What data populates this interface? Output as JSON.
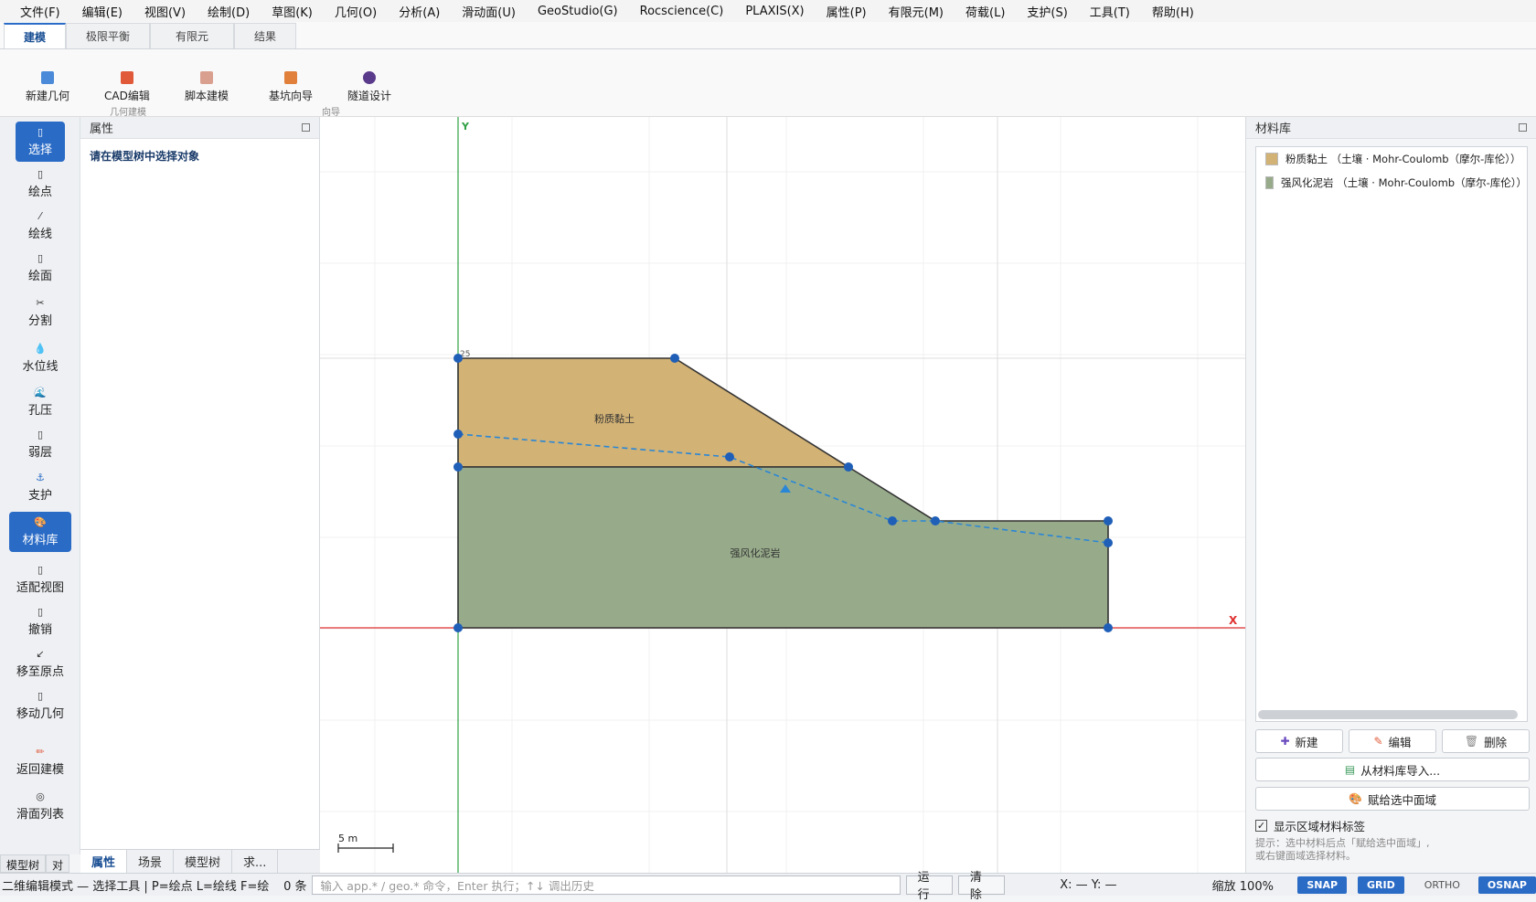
{
  "menu": [
    "文件(F)",
    "编辑(E)",
    "视图(V)",
    "绘制(D)",
    "草图(K)",
    "几何(O)",
    "分析(A)",
    "滑动面(U)",
    "GeoStudio(G)",
    "Rocscience(C)",
    "PLAXIS(X)",
    "属性(P)",
    "有限元(M)",
    "荷载(L)",
    "支护(S)",
    "工具(T)",
    "帮助(H)"
  ],
  "ribbon": {
    "tabs": [
      "建模",
      "极限平衡",
      "有限元",
      "结果"
    ],
    "buttons": [
      "新建几何",
      "CAD编辑",
      "脚本建模",
      "基坑向导",
      "隧道设计"
    ],
    "groups": [
      "几何建模",
      "向导"
    ]
  },
  "toolbar": [
    {
      "label": "选择",
      "glyph": "▯"
    },
    {
      "label": "绘点",
      "glyph": "▯"
    },
    {
      "label": "绘线",
      "glyph": "⁄"
    },
    {
      "label": "绘面",
      "glyph": "▯"
    },
    {
      "label": "分割",
      "glyph": "✂"
    },
    {
      "label": "水位线",
      "glyph": "💧"
    },
    {
      "label": "孔压",
      "glyph": "🌊"
    },
    {
      "label": "弱层",
      "glyph": "▯"
    },
    {
      "label": "支护",
      "glyph": "⚓"
    },
    {
      "label": "材料库",
      "glyph": "🎨"
    },
    {
      "label": "适配视图",
      "glyph": "▯"
    },
    {
      "label": "撤销",
      "glyph": "▯"
    },
    {
      "label": "移至原点",
      "glyph": "↙"
    },
    {
      "label": "移动几何",
      "glyph": "▯"
    },
    {
      "label": "返回建模",
      "glyph": "✏"
    },
    {
      "label": "滑面列表",
      "glyph": "◎"
    }
  ],
  "left_tabs": [
    "模型树",
    "对"
  ],
  "props": {
    "title": "属性",
    "hint": "请在模型树中选择对象",
    "tabs": [
      "属性",
      "场景",
      "模型树",
      "求..."
    ]
  },
  "canvas": {
    "axis_y": "Y",
    "axis_x": "X",
    "y_tick": "25",
    "region1": "粉质黏土",
    "region2": "强风化泥岩",
    "scale": "5 m",
    "colors": {
      "clay": "#d2b275",
      "rock": "#97ab8a",
      "water": "#2a86d6",
      "axis_x": "#e03030",
      "axis_y": "#2ea043"
    }
  },
  "matlib": {
    "title": "材料库",
    "materials": [
      {
        "name": "粉质黏土 （土壤 · Mohr-Coulomb（摩尔-库伦））",
        "color": "#d2b275"
      },
      {
        "name": "强风化泥岩 （土壤 · Mohr-Coulomb（摩尔-库伦））",
        "color": "#97ab8a"
      }
    ],
    "btn_new": "新建",
    "btn_edit": "编辑",
    "btn_delete": "删除",
    "btn_import": "从材料库导入...",
    "btn_assign": "赋给选中面域",
    "show_labels": "显示区域材料标签",
    "tip1": "提示：选中材料后点「赋给选中面域」,",
    "tip2": "或右键面域选择材料。"
  },
  "status": {
    "mode": "二维编辑模式 — 选择工具 | P=绘点 L=绘线 F=绘",
    "count": "0 条",
    "cmd_placeholder": "输入 app.* / geo.* 命令，Enter 执行；↑↓ 调出历史",
    "run": "运行",
    "clear": "清除",
    "xy": "X: —  Y: —",
    "zoom": "缩放 100%",
    "snap": "SNAP",
    "grid": "GRID",
    "ortho": "ORTHO",
    "osnap": "OSNAP"
  }
}
